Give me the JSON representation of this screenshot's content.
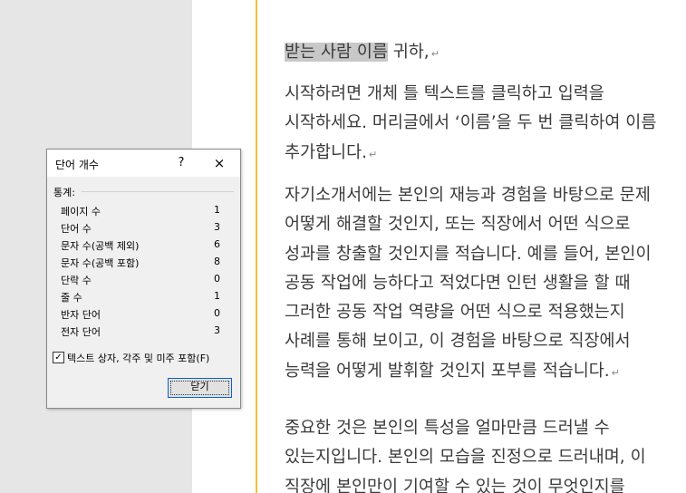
{
  "document": {
    "paragraphs": [
      [
        "받는 사람 이름 귀하,"
      ],
      [
        "시작하려면 개체 틀 텍스트를 클릭하고 입력을",
        "시작하세요. 머리글에서 ‘이름’을 두 번 클릭하여 이름",
        "추가합니다."
      ],
      [
        "자기소개서에는 본인의 재능과 경험을 바탕으로 문제",
        "어떻게 해결할 것인지, 또는 직장에서 어떤 식으로",
        "성과를 창출할 것인지를 적습니다. 예를 들어, 본인이",
        "공동 작업에 능하다고 적었다면 인턴 생활을 할 때",
        "그러한 공동 작업 역량을 어떤 식으로 적용했는지",
        "사례를 통해 보이고, 이 경험을 바탕으로 직장에서",
        "능력을 어떻게 발휘할 것인지 포부를 적습니다."
      ],
      [
        "중요한 것은 본인의 특성을 얼마만큼 드러낼 수",
        "있는지입니다. 본인의 모습을 진정으로 드러내며, 이",
        "직장에 본인만이 기여할 수 있는 것이 무엇인지를"
      ]
    ],
    "selected_text": "받는 사람 이름",
    "paragraph_mark": "↵",
    "margin_color": "#f2c037"
  },
  "dialog": {
    "title": "단어 개수",
    "help_label": "?",
    "close_icon": "×",
    "stats_label": "통계:",
    "stats": [
      {
        "name": "페이지 수",
        "value": "1"
      },
      {
        "name": "단어 수",
        "value": "3"
      },
      {
        "name": "문자 수(공백 제외)",
        "value": "6"
      },
      {
        "name": "문자 수(공백 포함)",
        "value": "8"
      },
      {
        "name": "단락 수",
        "value": "0"
      },
      {
        "name": "줄 수",
        "value": "1"
      },
      {
        "name": "반자 단어",
        "value": "0"
      },
      {
        "name": "전자 단어",
        "value": "3"
      }
    ],
    "checkbox_label": "텍스트 상자, 각주 및 미주 포함(F)",
    "checkbox_checked": true,
    "close_button_label": "닫기"
  }
}
